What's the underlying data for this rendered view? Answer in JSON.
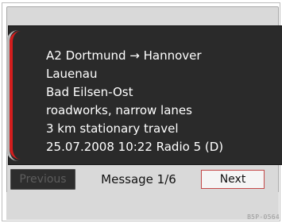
{
  "traffic_message": {
    "route": "A2 Dortmund → Hannover",
    "from_location": "Lauenau",
    "to_location": "Bad Eilsen-Ost",
    "event": "roadworks, narrow lanes",
    "extent": "3 km stationary travel",
    "source": "25.07.2008   10:22   Radio 5 (D)"
  },
  "controls": {
    "previous_label": "Previous",
    "status_label": "Message 1/6",
    "next_label": "Next"
  },
  "figure_code": "B5P-0564"
}
